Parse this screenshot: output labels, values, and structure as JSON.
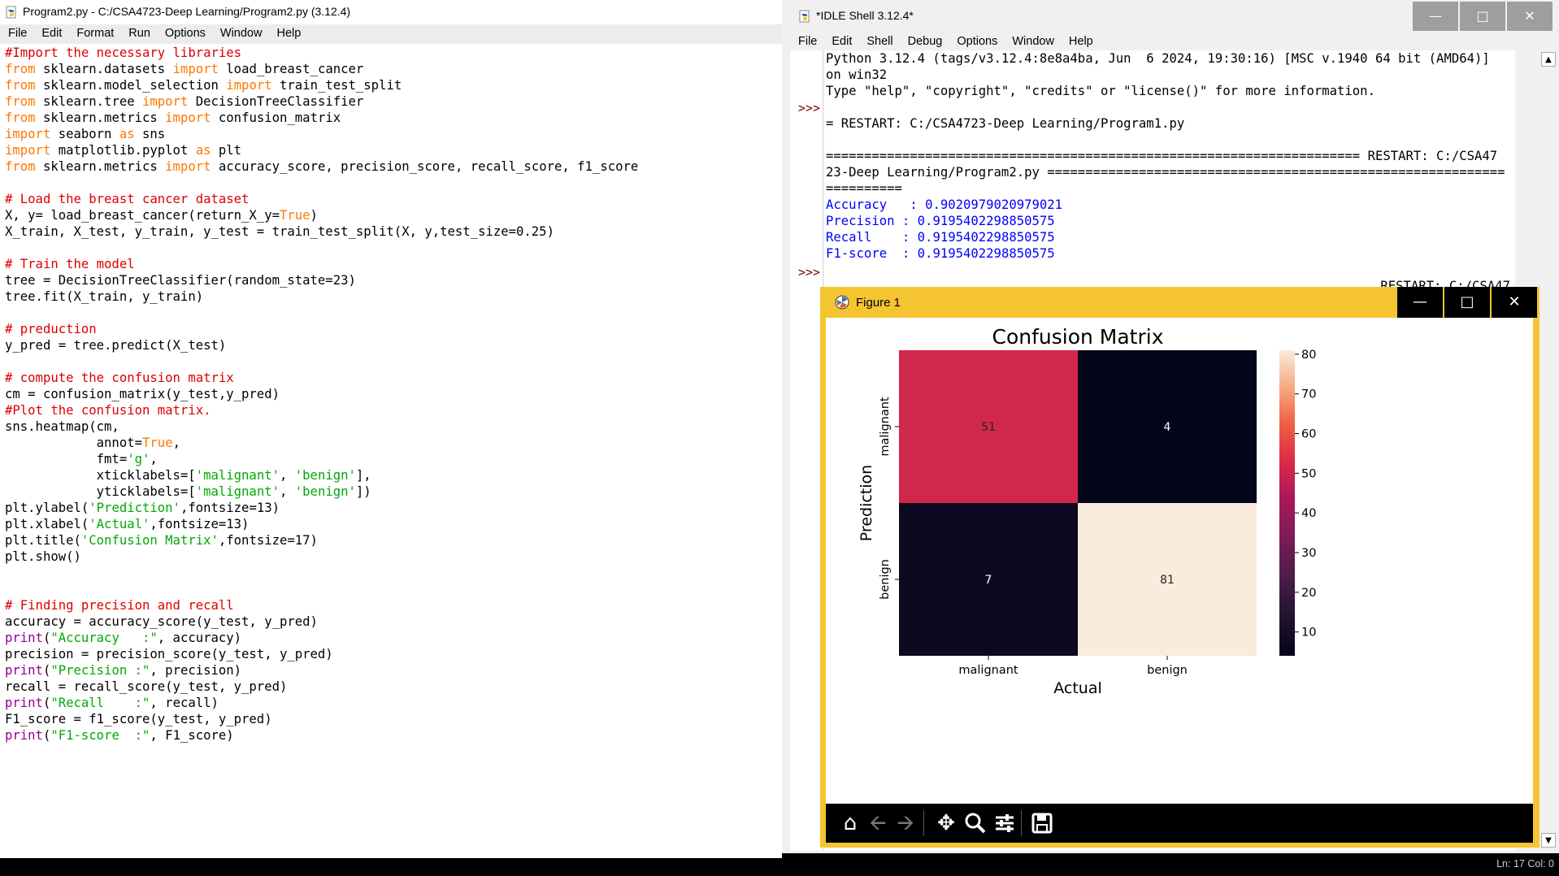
{
  "editor": {
    "title": "Program2.py - C:/CSA4723-Deep Learning/Program2.py (3.12.4)",
    "menu": [
      "File",
      "Edit",
      "Format",
      "Run",
      "Options",
      "Window",
      "Help"
    ],
    "code_lines": [
      "#Import the necessary libraries",
      "from sklearn.datasets import load_breast_cancer",
      "from sklearn.model_selection import train_test_split",
      "from sklearn.tree import DecisionTreeClassifier",
      "from sklearn.metrics import confusion_matrix",
      "import seaborn as sns",
      "import matplotlib.pyplot as plt",
      "from sklearn.metrics import accuracy_score, precision_score, recall_score, f1_score",
      "",
      "# Load the breast cancer dataset",
      "X, y= load_breast_cancer(return_X_y=True)",
      "X_train, X_test, y_train, y_test = train_test_split(X, y,test_size=0.25)",
      "",
      "# Train the model",
      "tree = DecisionTreeClassifier(random_state=23)",
      "tree.fit(X_train, y_train)",
      "",
      "# preduction",
      "y_pred = tree.predict(X_test)",
      "",
      "# compute the confusion matrix",
      "cm = confusion_matrix(y_test,y_pred)",
      "#Plot the confusion matrix.",
      "sns.heatmap(cm,",
      "            annot=True,",
      "            fmt='g',",
      "            xticklabels=['malignant', 'benign'],",
      "            yticklabels=['malignant', 'benign'])",
      "plt.ylabel('Prediction',fontsize=13)",
      "plt.xlabel('Actual',fontsize=13)",
      "plt.title('Confusion Matrix',fontsize=17)",
      "plt.show()",
      "",
      "",
      "# Finding precision and recall",
      "accuracy = accuracy_score(y_test, y_pred)",
      "print(\"Accuracy   :\", accuracy)",
      "precision = precision_score(y_test, y_pred)",
      "print(\"Precision :\", precision)",
      "recall = recall_score(y_test, y_pred)",
      "print(\"Recall    :\", recall)",
      "F1_score = f1_score(y_test, y_pred)",
      "print(\"F1-score  :\", F1_score)"
    ]
  },
  "shell": {
    "title": "*IDLE Shell 3.12.4*",
    "menu": [
      "File",
      "Edit",
      "Shell",
      "Debug",
      "Options",
      "Window",
      "Help"
    ],
    "prompt": ">>>",
    "banner": [
      "Python 3.12.4 (tags/v3.12.4:8e8a4ba, Jun  6 2024, 19:30:16) [MSC v.1940 64 bit (AMD64)]",
      "on win32",
      "Type \"help\", \"copyright\", \"credits\" or \"license()\" for more information."
    ],
    "restart1": "= RESTART: C:/CSA4723-Deep Learning/Program1.py",
    "restart2": [
      "====================================================================== RESTART: C:/CSA47",
      "23-Deep Learning/Program2.py ============================================================",
      "=========="
    ],
    "results": [
      {
        "label": "Accuracy   :",
        "value": "0.9020979020979021"
      },
      {
        "label": "Precision :",
        "value": "0.9195402298850575"
      },
      {
        "label": "Recall    :",
        "value": "0.9195402298850575"
      },
      {
        "label": "F1-score  :",
        "value": "0.9195402298850575"
      }
    ],
    "partial_hidden": "RESTART: C:/CSA47",
    "status": "Ln: 17   Col: 0"
  },
  "figure": {
    "title": "Figure 1",
    "toolbar_icons": [
      "home-icon",
      "back-icon",
      "forward-icon",
      "pan-icon",
      "zoom-icon",
      "configure-icon",
      "save-icon"
    ]
  },
  "colors": {
    "figure_border": "#f5c531",
    "keyword": "#ff7700",
    "comment": "#dd0000",
    "string": "#00aa00",
    "builtin": "#900090",
    "output": "#0000ff"
  },
  "chart_data": {
    "type": "heatmap",
    "title": "Confusion Matrix",
    "xlabel": "Actual",
    "ylabel": "Prediction",
    "x_categories": [
      "malignant",
      "benign"
    ],
    "y_categories": [
      "malignant",
      "benign"
    ],
    "values": [
      [
        51,
        4
      ],
      [
        7,
        81
      ]
    ],
    "colorbar": {
      "min": 4,
      "max": 81,
      "ticks": [
        10,
        20,
        30,
        40,
        50,
        60,
        70,
        80
      ]
    },
    "colormap": "rocket"
  }
}
